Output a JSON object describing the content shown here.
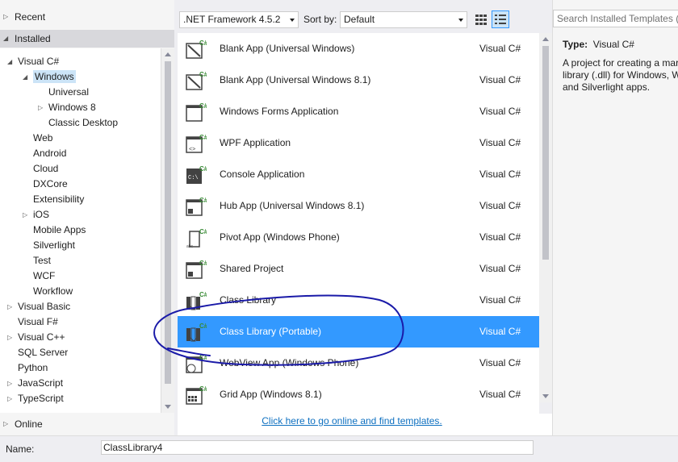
{
  "left": {
    "recent": "Recent",
    "installed": "Installed",
    "online": "Online",
    "tree": [
      {
        "label": "Visual C#",
        "expander": "◢"
      },
      {
        "label": "Windows",
        "expander": "◢",
        "selected": true
      },
      {
        "label": "Universal",
        "expander": ""
      },
      {
        "label": "Windows 8",
        "expander": "▷"
      },
      {
        "label": "Classic Desktop",
        "expander": ""
      },
      {
        "label": "Web",
        "expander": ""
      },
      {
        "label": "Android",
        "expander": ""
      },
      {
        "label": "Cloud",
        "expander": ""
      },
      {
        "label": "DXCore",
        "expander": ""
      },
      {
        "label": "Extensibility",
        "expander": ""
      },
      {
        "label": "iOS",
        "expander": "▷"
      },
      {
        "label": "Mobile Apps",
        "expander": ""
      },
      {
        "label": "Silverlight",
        "expander": ""
      },
      {
        "label": "Test",
        "expander": ""
      },
      {
        "label": "WCF",
        "expander": ""
      },
      {
        "label": "Workflow",
        "expander": ""
      },
      {
        "label": "Visual Basic",
        "expander": "▷"
      },
      {
        "label": "Visual F#",
        "expander": ""
      },
      {
        "label": "Visual C++",
        "expander": "▷"
      },
      {
        "label": "SQL Server",
        "expander": ""
      },
      {
        "label": "Python",
        "expander": ""
      },
      {
        "label": "JavaScript",
        "expander": "▷"
      },
      {
        "label": "TypeScript",
        "expander": "▷"
      }
    ]
  },
  "toolbar": {
    "framework": ".NET Framework 4.5.2",
    "sort_label": "Sort by:",
    "sort_value": "Default"
  },
  "templates": [
    {
      "name": "Blank App (Universal Windows)",
      "lang": "Visual C#",
      "icon": "blank-app-icon"
    },
    {
      "name": "Blank App (Universal Windows 8.1)",
      "lang": "Visual C#",
      "icon": "blank-app-icon"
    },
    {
      "name": "Windows Forms Application",
      "lang": "Visual C#",
      "icon": "windows-forms-icon"
    },
    {
      "name": "WPF Application",
      "lang": "Visual C#",
      "icon": "wpf-icon"
    },
    {
      "name": "Console Application",
      "lang": "Visual C#",
      "icon": "console-icon"
    },
    {
      "name": "Hub App (Universal Windows 8.1)",
      "lang": "Visual C#",
      "icon": "hub-app-icon"
    },
    {
      "name": "Pivot App (Windows Phone)",
      "lang": "Visual C#",
      "icon": "pivot-app-icon"
    },
    {
      "name": "Shared Project",
      "lang": "Visual C#",
      "icon": "shared-project-icon"
    },
    {
      "name": "Class Library",
      "lang": "Visual C#",
      "icon": "class-library-icon"
    },
    {
      "name": "Class Library (Portable)",
      "lang": "Visual C#",
      "icon": "class-library-portable-icon",
      "selected": true
    },
    {
      "name": "WebView App (Windows Phone)",
      "lang": "Visual C#",
      "icon": "webview-app-icon"
    },
    {
      "name": "Grid App (Windows 8.1)",
      "lang": "Visual C#",
      "icon": "grid-app-icon"
    }
  ],
  "online_link": "Click here to go online and find templates.",
  "right": {
    "search_placeholder": "Search Installed Templates (C",
    "type_label": "Type:",
    "type_value": "Visual C#",
    "description": "A project for creating a mar\nlibrary (.dll) for Windows, W\nand Silverlight apps."
  },
  "bottom": {
    "name_label": "Name:",
    "name_value": "ClassLibrary4"
  },
  "colors": {
    "selection": "#3399ff",
    "link": "#0e70c0",
    "annotation": "#1a1aa8"
  }
}
